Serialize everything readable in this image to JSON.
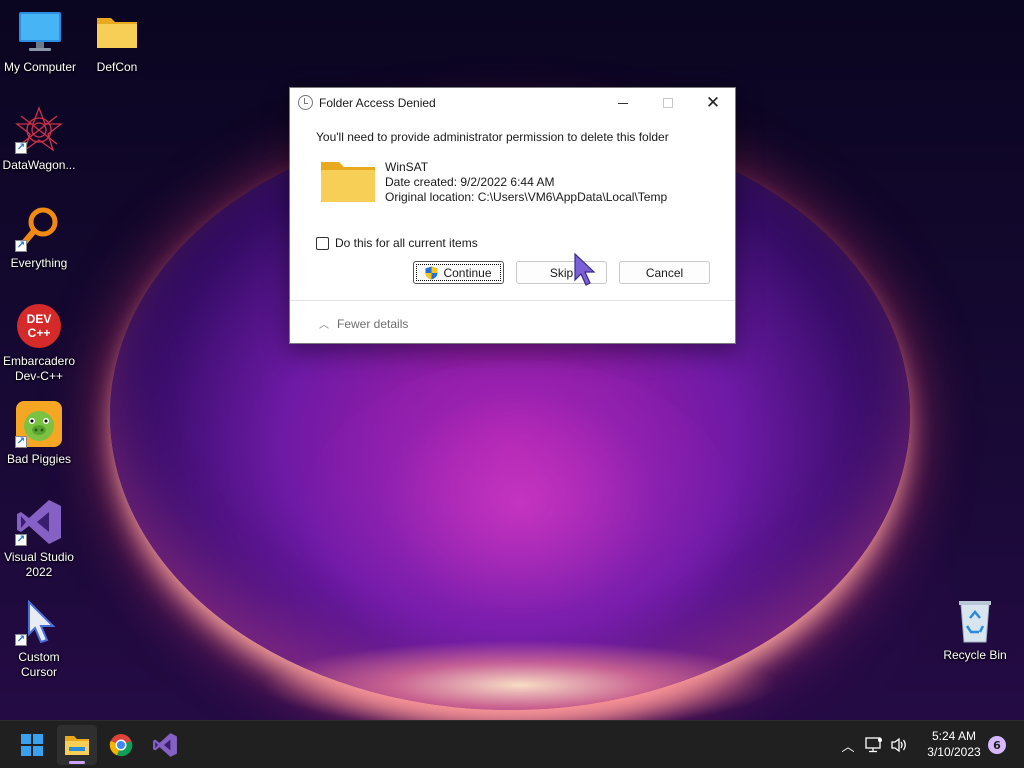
{
  "desktop": {
    "icons": [
      {
        "label": "My Computer",
        "icon": "monitor-icon"
      },
      {
        "label": "DefCon",
        "icon": "folder-icon"
      },
      {
        "label": "DataWagon...",
        "icon": "datawagon-icon"
      },
      {
        "label": "Everything",
        "icon": "everything-search-icon"
      },
      {
        "label": "Embarcadero\nDev-C++",
        "icon": "devcpp-icon"
      },
      {
        "label": "Bad Piggies",
        "icon": "bad-piggies-icon"
      },
      {
        "label": "Visual Studio\n2022",
        "icon": "visual-studio-icon"
      },
      {
        "label": "Custom\nCursor",
        "icon": "custom-cursor-icon"
      },
      {
        "label": "Recycle Bin",
        "icon": "recycle-bin-icon"
      }
    ]
  },
  "dialog": {
    "title": "Folder Access Denied",
    "message": "You'll need to provide administrator permission to delete this folder",
    "item_name": "WinSAT",
    "date_created": "Date created: 9/2/2022 6:44 AM",
    "original_location": "Original location: C:\\Users\\VM6\\AppData\\Local\\Temp",
    "checkbox_label": "Do this for all current items",
    "checkbox_checked": false,
    "buttons": {
      "continue": "Continue",
      "skip": "Skip",
      "cancel": "Cancel"
    },
    "details_toggle": "Fewer details"
  },
  "taskbar": {
    "apps": [
      "start-icon",
      "file-explorer-icon",
      "chrome-icon",
      "visual-studio-icon"
    ],
    "clock_time": "5:24 AM",
    "clock_date": "3/10/2023",
    "notification_count": "6"
  },
  "colors": {
    "accent": "#c9a3ff",
    "taskbar": "#202020",
    "folder": "#f4c542"
  }
}
